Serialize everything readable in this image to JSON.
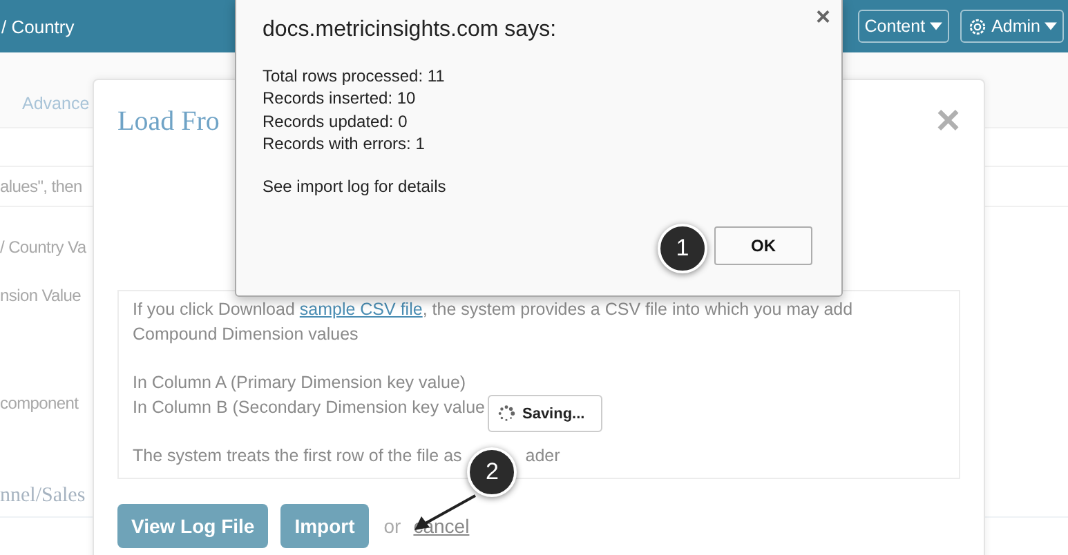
{
  "top_bar": {
    "breadcrumb": "/ Country",
    "buttons": [
      {
        "label": "Content",
        "kind": "plain"
      },
      {
        "label": "Admin",
        "kind": "gear"
      }
    ]
  },
  "background": {
    "tab": "Advance",
    "fragments": [
      {
        "text": "alues\", then",
        "kind": "line"
      },
      {
        "text": "/ Country Va",
        "kind": "line"
      },
      {
        "text": "nsion Value",
        "kind": "line"
      },
      {
        "text": "component",
        "kind": "line"
      },
      {
        "text": "nnel/Sales",
        "kind": "heading"
      }
    ]
  },
  "modal": {
    "title": "Load Fro",
    "close": "×",
    "intro": {
      "before": "If you click Download ",
      "link": "sample CSV file",
      "after": ", the system provides a CSV file into which you may add Compound Dimension values"
    },
    "columns": [
      "In Column A (Primary Dimension key value)",
      "In Column B (Secondary Dimension key value"
    ],
    "note": "The system treats the first row of the file as",
    "note_tail": "ader",
    "buttons": [
      "View Log File",
      "Import"
    ],
    "or": "or",
    "cancel": "cancel"
  },
  "saving": "Saving...",
  "alert": {
    "title": "docs.metricinsights.com says:",
    "close": "×",
    "lines": [
      "Total rows processed: 11",
      "Records inserted: 10",
      "Records updated: 0",
      "Records with errors: 1"
    ],
    "note": "See import log for details",
    "ok": "OK"
  },
  "callouts": [
    "1",
    "2"
  ]
}
